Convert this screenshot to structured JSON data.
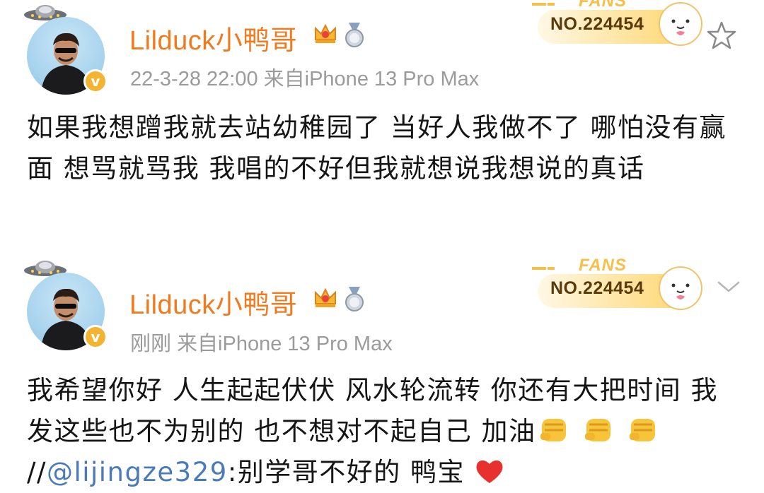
{
  "posts": [
    {
      "username": "Lilduck小鸭哥",
      "meta": "22-3-28 22:00  来自iPhone 13 Pro Max",
      "fans_label": "FANS",
      "fans_no": "NO.224454",
      "text": "如果我想蹭我就去站幼稚园了 当好人我做不了 哪怕没有赢面 想骂就骂我 我唱的不好但我就想说我想说的真话",
      "action_icon": "star-icon"
    },
    {
      "username": "Lilduck小鸭哥",
      "meta": "刚刚  来自iPhone 13 Pro Max",
      "fans_label": "FANS",
      "fans_no": "NO.224454",
      "text_main": "我希望你好 人生起起伏伏 风水轮流转 你还有大把时间 我发这些也不为别的 也不想对不起自己 加油",
      "repost_prefix": "//",
      "mention": "@lijingze329",
      "repost_text": ":别学哥不好的 鸭宝",
      "action_icon": "chevron-down-icon"
    }
  ],
  "colors": {
    "username": "#f07a1d",
    "meta": "#9b9b9b",
    "mention": "#4a7bb8",
    "fans_gold": "#f5c04a",
    "verified": "#f4b431"
  }
}
